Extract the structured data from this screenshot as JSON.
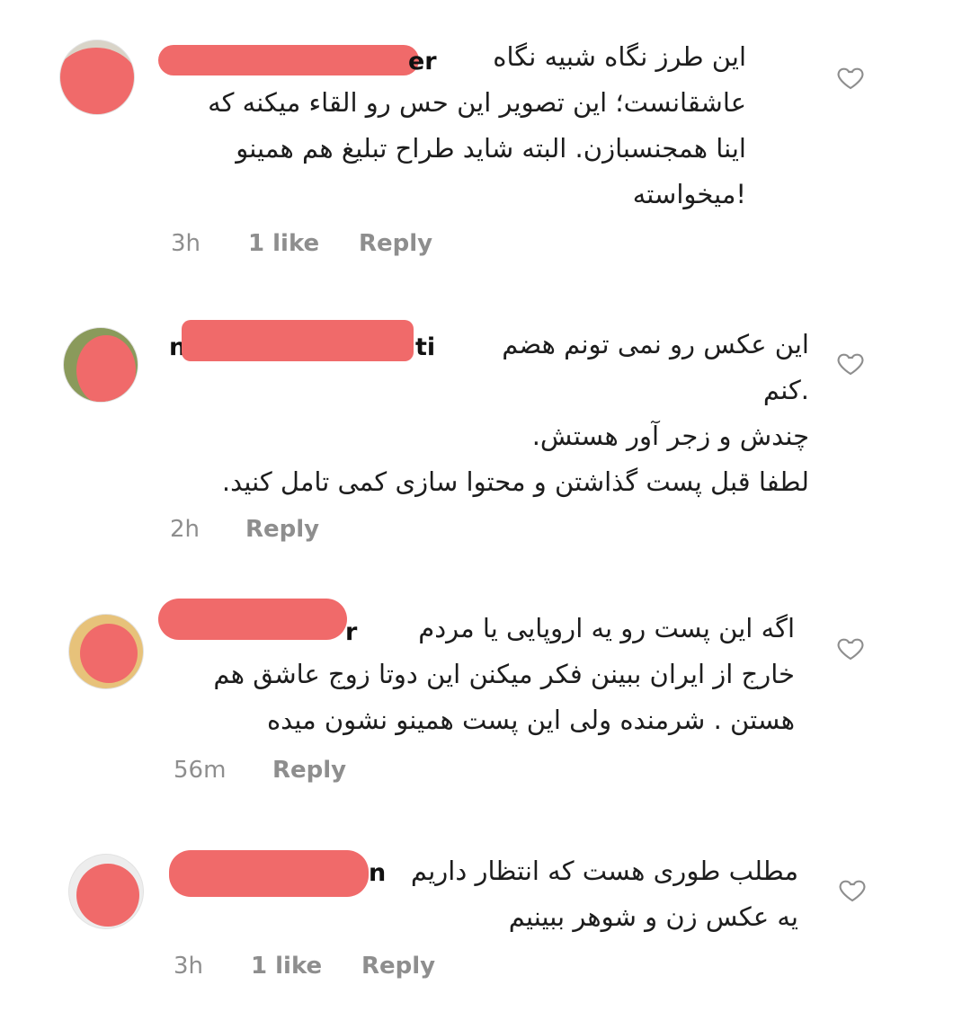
{
  "comments": [
    {
      "username_visible": "er",
      "text": "این طرز نگاه شبیه نگاه\nعاشقانست؛ این تصویر این حس رو القاء میکنه که\nاینا همجنسبازن. البته شاید طراح تبلیغ هم همینو\n!میخواسته",
      "time": "3h",
      "likes": "1 like",
      "reply": "Reply"
    },
    {
      "username_visible": "ti",
      "username_lead": "n",
      "text": "این عکس رو نمی تونم هضم\n.کنم\nچندش و زجر آور هستش.\nلطفا قبل پست گذاشتن و محتوا سازی کمی تامل کنید.",
      "time": "2h",
      "likes": "",
      "reply": "Reply"
    },
    {
      "username_visible": "r",
      "text": "اگه این پست رو یه اروپایی یا مردم\nخارج از ایران ببینن فکر میکنن این دوتا زوج عاشق هم\nهستن . شرمنده ولی این پست همینو نشون میده",
      "time": "56m",
      "likes": "",
      "reply": "Reply"
    },
    {
      "username_visible": "n",
      "text": "مطلب طوری هست که انتظار داریم\nیه عکس زن و شوهر ببینیم",
      "time": "3h",
      "likes": "1 like",
      "reply": "Reply"
    }
  ],
  "icons": {
    "like": "heart-outline-icon"
  },
  "colors": {
    "redaction": "#f06a6a",
    "meta_text": "#8e8e8e",
    "body_text": "#1d1d1d"
  }
}
